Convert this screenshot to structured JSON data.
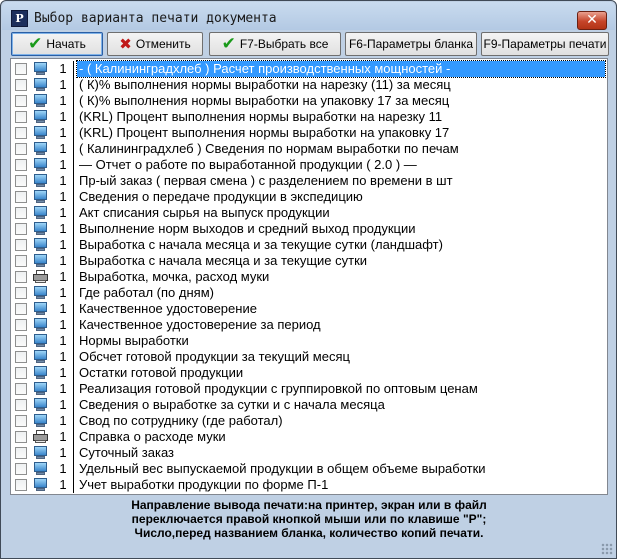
{
  "window": {
    "title": "Выбор варианта печати документа",
    "app_icon_letter": "Р",
    "close_symbol": "✕"
  },
  "toolbar": {
    "start_label": "Начать",
    "cancel_label": "Отменить",
    "select_all_label": "F7-Выбрать все",
    "form_params_label": "F6-Параметры бланка",
    "print_params_label": "F9-Параметры печати"
  },
  "list": {
    "items": [
      {
        "label": "- ( Калининградхлеб ) Расчет производственных мощностей -",
        "copies": "1",
        "device": "monitor",
        "selected": true
      },
      {
        "label": "( К)% выполнения нормы выработки на нарезку (11) за месяц",
        "copies": "1",
        "device": "monitor"
      },
      {
        "label": "( К)% выполнения нормы выработки на упаковку 17 за месяц",
        "copies": "1",
        "device": "monitor"
      },
      {
        "label": "(KRL) Процент выполнения нормы выработки на нарезку 11",
        "copies": "1",
        "device": "monitor"
      },
      {
        "label": "(KRL) Процент выполнения нормы выработки на упаковку 17",
        "copies": "1",
        "device": "monitor"
      },
      {
        "label": "( Калининградхлеб ) Сведения по нормам выработки по печам",
        "copies": "1",
        "device": "monitor"
      },
      {
        "label": "— Отчет о работе по выработанной продукции ( 2.0 ) —",
        "copies": "1",
        "device": "monitor"
      },
      {
        "label": "Пр-ый заказ ( первая смена ) с разделением по времени в шт",
        "copies": "1",
        "device": "monitor"
      },
      {
        "label": "Сведения о передаче продукции в экспедицию",
        "copies": "1",
        "device": "monitor"
      },
      {
        "label": "Акт списания сырья на выпуск продукции",
        "copies": "1",
        "device": "monitor"
      },
      {
        "label": "Выполнение норм выходов и средний выход продукции",
        "copies": "1",
        "device": "monitor"
      },
      {
        "label": "Выработка с начала месяца и за текущие сутки (ландшафт)",
        "copies": "1",
        "device": "monitor"
      },
      {
        "label": "Выработка с начала месяца и за текущие сутки",
        "copies": "1",
        "device": "monitor"
      },
      {
        "label": "Выработка, мочка, расход муки",
        "copies": "1",
        "device": "printer"
      },
      {
        "label": "Где работал (по дням)",
        "copies": "1",
        "device": "monitor"
      },
      {
        "label": "Качественное удостоверение",
        "copies": "1",
        "device": "monitor"
      },
      {
        "label": "Качественное удостоверение за период",
        "copies": "1",
        "device": "monitor"
      },
      {
        "label": "Нормы выработки",
        "copies": "1",
        "device": "monitor"
      },
      {
        "label": "Обсчет готовой продукции за текущий месяц",
        "copies": "1",
        "device": "monitor"
      },
      {
        "label": "Остатки готовой продукции",
        "copies": "1",
        "device": "monitor"
      },
      {
        "label": "Реализация готовой продукции с группировкой по оптовым ценам",
        "copies": "1",
        "device": "monitor"
      },
      {
        "label": "Сведения о выработке за сутки и с начала месяца",
        "copies": "1",
        "device": "monitor"
      },
      {
        "label": "Свод по сотруднику (где работал)",
        "copies": "1",
        "device": "monitor"
      },
      {
        "label": "Справка о расходе муки",
        "copies": "1",
        "device": "printer"
      },
      {
        "label": "Суточный заказ",
        "copies": "1",
        "device": "monitor"
      },
      {
        "label": "Удельный вес выпускаемой продукции в общем объеме выработки",
        "copies": "1",
        "device": "monitor"
      },
      {
        "label": "Учет выработки продукции по форме П-1",
        "copies": "1",
        "device": "monitor"
      }
    ]
  },
  "footer": {
    "line1": "Направление вывода печати:на принтер, экран или в файл",
    "line2": "переключается правой кнопкой мыши или по клавише \"Р\";",
    "line3": "Число,перед названием бланка, количество копий печати."
  },
  "colors": {
    "selection": "#3399ff",
    "frame": "#bfd0e4"
  }
}
